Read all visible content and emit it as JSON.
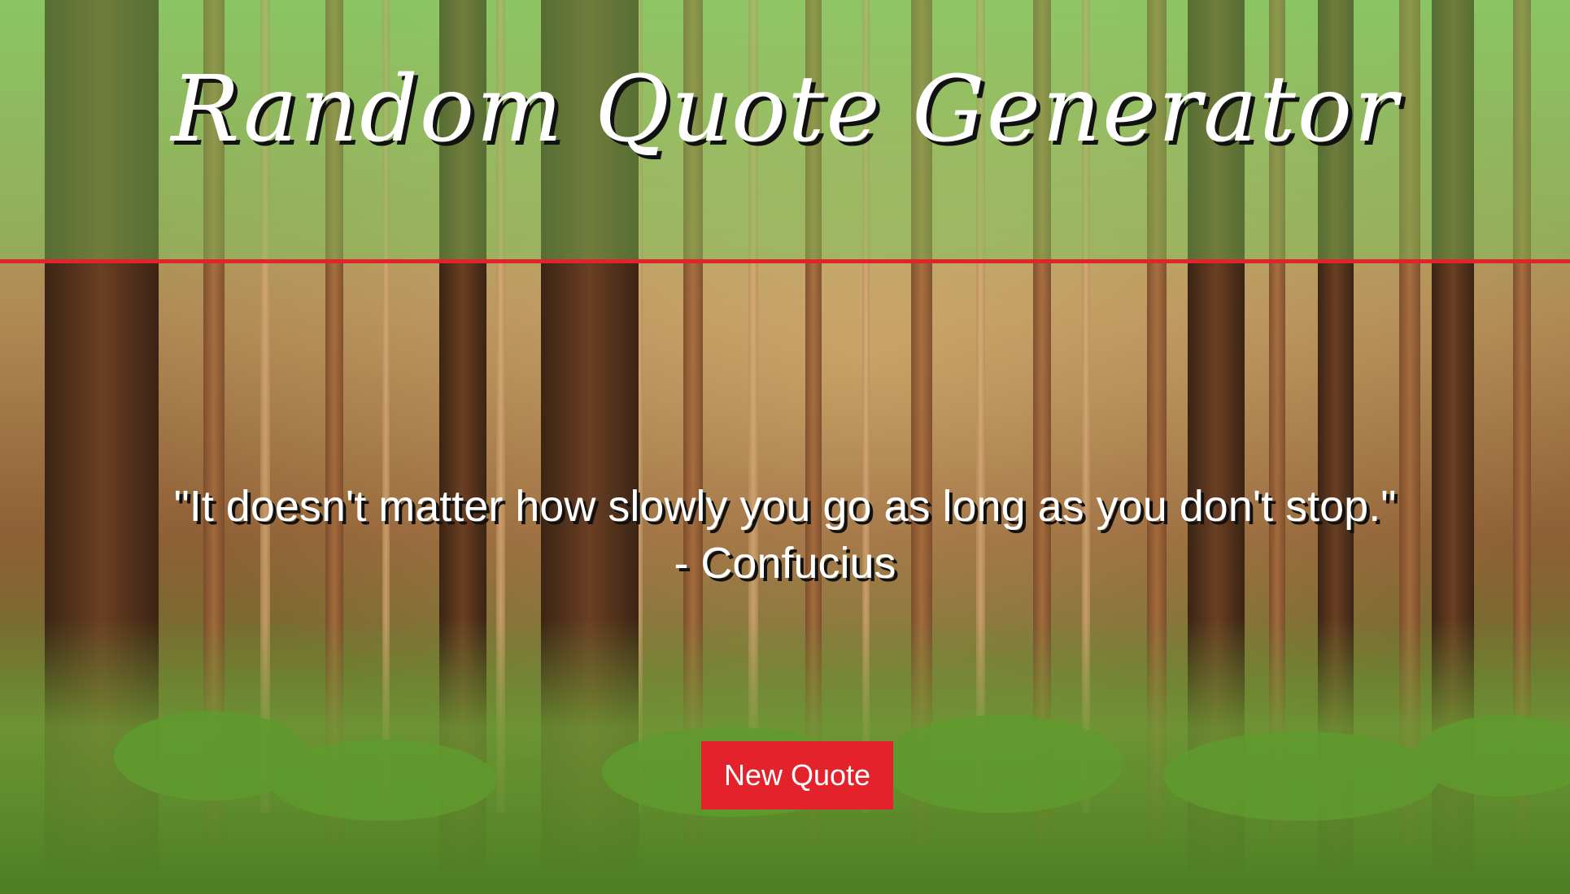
{
  "header": {
    "title": "Random Quote Generator"
  },
  "quote": {
    "text": "\"It doesn't matter how slowly you go as long as you don't stop.\" - Confucius"
  },
  "actions": {
    "new_quote_label": "New Quote"
  },
  "colors": {
    "accent": "#e3222b",
    "header_tint": "#78c85a",
    "text": "#ffffff"
  }
}
